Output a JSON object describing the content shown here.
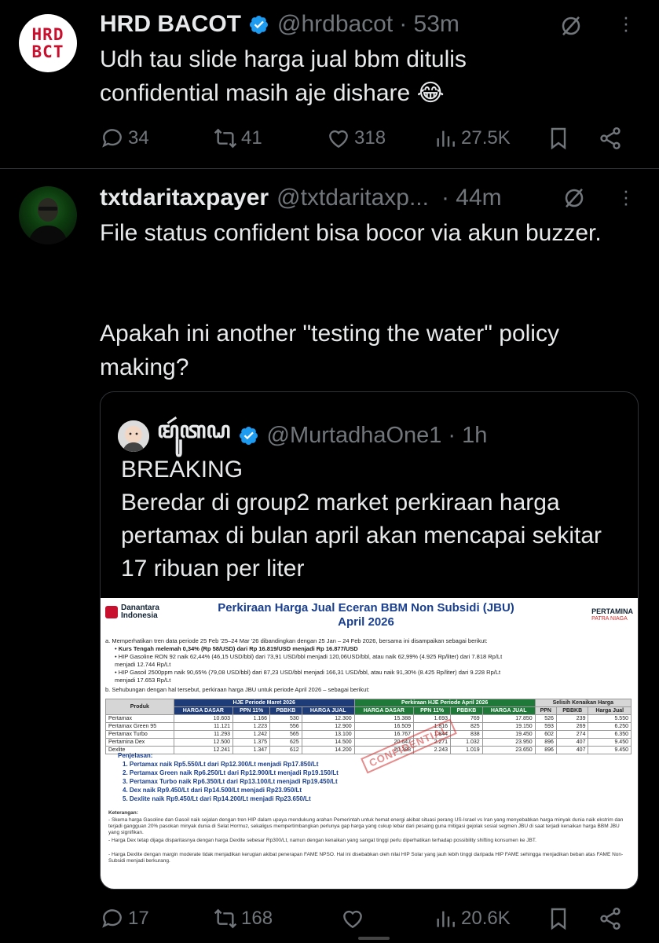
{
  "post1": {
    "avatar_text": [
      "HRD",
      "BCT"
    ],
    "name": "HRD BACOT",
    "handle": "@hrdbacot",
    "time": "· 53m",
    "text": "Udh tau slide harga jual bbm ditulis confidential masih aje dishare 😂",
    "replies": "34",
    "reposts": "41",
    "likes": "318",
    "views": "27.5K"
  },
  "post2": {
    "name": "txtdaritaxpayer",
    "handle": "@txtdaritaxp...",
    "time": "· 44m",
    "text_1": "File status confident bisa bocor via akun buzzer.",
    "text_2": "Apakah ini another \"testing the water\" policy making?",
    "replies": "17",
    "reposts": "168",
    "views": "20.6K",
    "quote": {
      "name": "ꦩꦸꦂꦠꦝ",
      "handle": "@MurtadhaOne1",
      "time": "· 1h",
      "text_1": "BREAKING",
      "text_2": "Beredar di group2 market perkiraan harga pertamax di bulan april akan mencapai sekitar 17 ribuan per liter"
    }
  },
  "doc": {
    "brand_left_1": "Danantara",
    "brand_left_2": "Indonesia",
    "title_1": "Perkiraan Harga Jual Eceran BBM Non Subsidi (JBU)",
    "title_2": "April 2026",
    "brand_right": "PERTAMINA",
    "brand_right_sub": "PATRA NIAGA",
    "line_a": "a. Memperhatikan tren data periode 25 Feb '25–24 Mar '26 dibandingkan dengan 25 Jan – 24 Feb 2026, bersama ini disampaikan sebagai berikut:",
    "bullet_1": "• Kurs Tengah melemah 0,34% (Rp 58/USD) dari Rp 16.819/USD menjadi Rp 16.877/USD",
    "bullet_2": "• HIP Gasoline RON 92 naik 62,44% (46,15 USD/bbl) dari 73,91 USD/bbl menjadi 120,06USD/bbl, atau naik 62,99% (4.925 Rp/liter) dari 7.818 Rp/Lt",
    "bullet_2b": "   menjadi 12.744 Rp/Lt",
    "bullet_3": "• HIP Gasoil 2500ppm naik 90,65% (79,08 USD/bbl) dari 87,23 USD/bbl menjadi 166,31 USD/bbl, atau naik 91,30% (8.425 Rp/liter) dari 9.228 Rp/Lt",
    "bullet_3b": "   menjadi 17.653 Rp/Lt",
    "line_b": "b. Sehubungan dengan hal tersebut, perkiraan harga JBU untuk periode April 2026 – sebagai berikut:",
    "group_headers": [
      "Produk",
      "HJE Periode Maret 2026",
      "Perkiraan HJE Periode April 2026",
      "Selisih Kenaikan Harga"
    ],
    "col_headers": [
      "HARGA DASAR",
      "PPN 11%",
      "PBBKB",
      "HARGA JUAL",
      "HARGA DASAR",
      "PPN 11%",
      "PBBKB",
      "HARGA JUAL",
      "PPN",
      "PBBKB",
      "Harga Jual"
    ],
    "rows": [
      [
        "Pertamax",
        "10.603",
        "1.166",
        "530",
        "12.300",
        "15.388",
        "1.693",
        "769",
        "17.850",
        "526",
        "239",
        "5.550"
      ],
      [
        "Pertamax Green 95",
        "11.121",
        "1.223",
        "556",
        "12.900",
        "16.509",
        "1.816",
        "825",
        "19.150",
        "593",
        "269",
        "6.250"
      ],
      [
        "Pertamax Turbo",
        "11.293",
        "1.242",
        "565",
        "13.100",
        "16.767",
        "1.844",
        "838",
        "19.450",
        "602",
        "274",
        "6.350"
      ],
      [
        "Pertamina Dex",
        "12.500",
        "1.375",
        "625",
        "14.500",
        "20.647",
        "2.271",
        "1.032",
        "23.950",
        "896",
        "407",
        "9.450"
      ],
      [
        "Dexlite",
        "12.241",
        "1.347",
        "612",
        "14.200",
        "20.388",
        "2.243",
        "1.019",
        "23.650",
        "896",
        "407",
        "9.450"
      ]
    ],
    "stamp": "CONFIDENTIAL",
    "penjelasan": "Penjelasan:",
    "list": [
      "1.  Pertamax naik Rp5.550/Lt dari Rp12.300/Lt menjadi Rp17.850/Lt",
      "2.  Pertamax Green naik Rp6.250/Lt dari Rp12.900/Lt menjadi Rp19.150/Lt",
      "3.  Pertamax Turbo naik Rp6.350/Lt dari Rp13.100/Lt menjadi Rp19.450/Lt",
      "4.  Dex naik Rp9.450/Lt dari Rp14.500/Lt menjadi Rp23.950/Lt",
      "5.  Dexlite naik Rp9.450/Lt dari Rp14.200/Lt menjadi Rp23.650/Lt"
    ],
    "keterangan": "Keterangan:",
    "notes": [
      "- Skema harga Gasoline dan Gasoil naik sejalan dengan tren HIP dalam upaya mendukung arahan Pemerintah untuk hemat energi akibat situasi perang US-Israel vs Iran yang menyebabkan harga minyak dunia naik ekstrim dan terjadi gangguan 20% pasokan minyak dunia di Selat Hormuz, sekaligus mempertimbangkan perlunya gap harga yang cukup lebar dari pesaing guna mitigasi gejolak sosial segmen JBU di saat terjadi kenaikan harga BBM JBU yang signifikan.",
      "- Harga Dex tetap dijaga disparitasnya dengan harga Dexlite sebesar Rp300/Lt, namun dengan kenaikan yang sangat tinggi perlu diperhatikan terhadap possibility shifting konsumen ke JBT.",
      "- Harga Dexlite dengan margin moderate tidak menjadikan kerugian akibat penerapan FAME NPSO. Hal ini disebabkan oleh nilai HIP Solar yang jauh lebih tinggi daripada HIP FAME sehingga menjadikan beban atas FAME Non-Subsidi menjadi berkurang."
    ]
  }
}
